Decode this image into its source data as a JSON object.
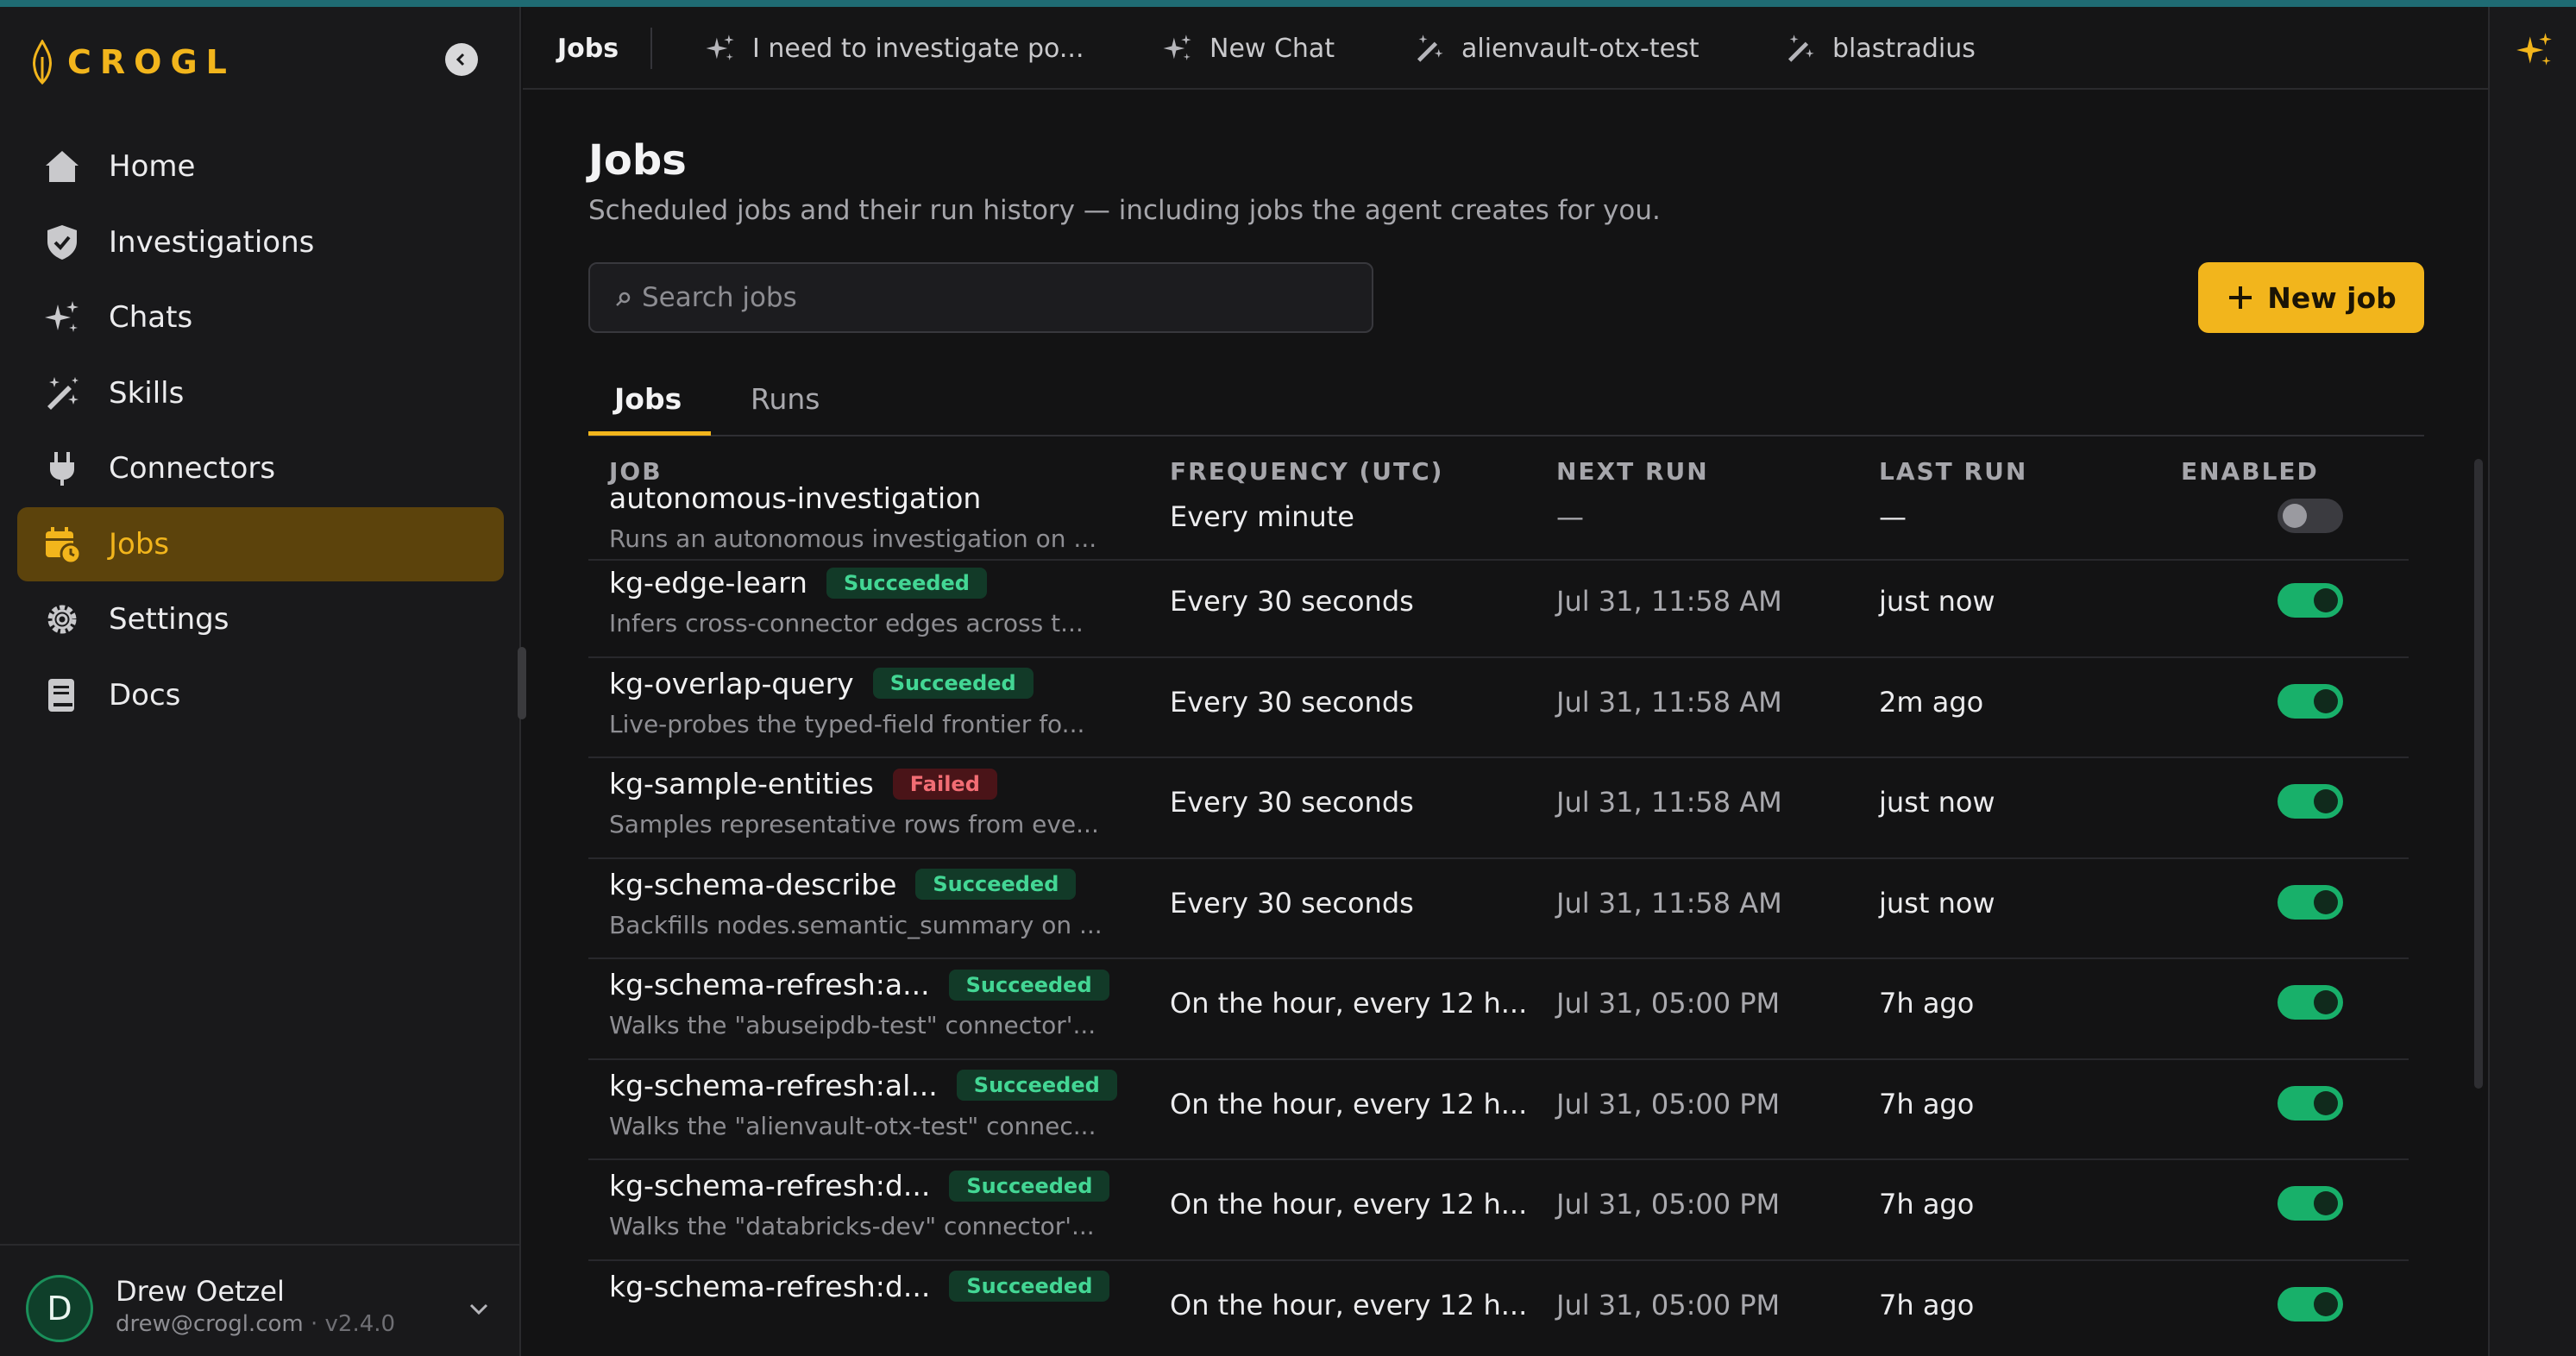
{
  "brand": {
    "name": "CROGL",
    "color": "#f2b51c"
  },
  "sidebar": {
    "items": [
      {
        "label": "Home",
        "icon": "home-icon"
      },
      {
        "label": "Investigations",
        "icon": "shield-icon"
      },
      {
        "label": "Chats",
        "icon": "sparkles-icon"
      },
      {
        "label": "Skills",
        "icon": "magic-wand-icon"
      },
      {
        "label": "Connectors",
        "icon": "plug-icon"
      },
      {
        "label": "Jobs",
        "icon": "calendar-clock-icon",
        "active": true
      },
      {
        "label": "Settings",
        "icon": "gear-icon"
      },
      {
        "label": "Docs",
        "icon": "book-icon"
      }
    ]
  },
  "user": {
    "initial": "D",
    "name": "Drew Oetzel",
    "email": "drew@crogl.com",
    "version": "· v2.4.0"
  },
  "tabs": [
    {
      "label": "Jobs",
      "active": true
    },
    {
      "label": "I need to investigate po...",
      "icon": "sparkles-icon"
    },
    {
      "label": "New Chat",
      "icon": "sparkles-icon"
    },
    {
      "label": "alienvault-otx-test",
      "icon": "magic-wand-icon"
    },
    {
      "label": "blastradius",
      "icon": "magic-wand-icon"
    }
  ],
  "page": {
    "title": "Jobs",
    "subtitle": "Scheduled jobs and their run history — including jobs the agent creates for you.",
    "search_placeholder": "Search jobs",
    "new_job_label": "New job",
    "subtabs": [
      "Jobs",
      "Runs"
    ]
  },
  "table": {
    "columns": [
      "JOB",
      "FREQUENCY (UTC)",
      "NEXT RUN",
      "LAST RUN",
      "ENABLED"
    ],
    "rows": [
      {
        "name": "autonomous-investigation",
        "status": "",
        "desc": "Runs an autonomous investigation on ...",
        "frequency": "Every minute",
        "next_run": "—",
        "last_run": "—",
        "enabled": false
      },
      {
        "name": "kg-edge-learn",
        "status": "Succeeded",
        "desc": "Infers cross-connector edges across t...",
        "frequency": "Every 30 seconds",
        "next_run": "Jul 31, 11:58 AM",
        "last_run": "just now",
        "enabled": true
      },
      {
        "name": "kg-overlap-query",
        "status": "Succeeded",
        "desc": "Live-probes the typed-field frontier fo...",
        "frequency": "Every 30 seconds",
        "next_run": "Jul 31, 11:58 AM",
        "last_run": "2m ago",
        "enabled": true
      },
      {
        "name": "kg-sample-entities",
        "status": "Failed",
        "desc": "Samples representative rows from eve...",
        "frequency": "Every 30 seconds",
        "next_run": "Jul 31, 11:58 AM",
        "last_run": "just now",
        "enabled": true
      },
      {
        "name": "kg-schema-describe",
        "status": "Succeeded",
        "desc": "Backfills nodes.semantic_summary on ...",
        "frequency": "Every 30 seconds",
        "next_run": "Jul 31, 11:58 AM",
        "last_run": "just now",
        "enabled": true
      },
      {
        "name": "kg-schema-refresh:a...",
        "status": "Succeeded",
        "desc": "Walks the \"abuseipdb-test\" connector'...",
        "frequency": "On the hour, every 12 h...",
        "next_run": "Jul 31, 05:00 PM",
        "last_run": "7h ago",
        "enabled": true
      },
      {
        "name": "kg-schema-refresh:al...",
        "status": "Succeeded",
        "desc": "Walks the \"alienvault-otx-test\" connec...",
        "frequency": "On the hour, every 12 h...",
        "next_run": "Jul 31, 05:00 PM",
        "last_run": "7h ago",
        "enabled": true
      },
      {
        "name": "kg-schema-refresh:d...",
        "status": "Succeeded",
        "desc": "Walks the \"databricks-dev\" connector'...",
        "frequency": "On the hour, every 12 h...",
        "next_run": "Jul 31, 05:00 PM",
        "last_run": "7h ago",
        "enabled": true
      },
      {
        "name": "kg-schema-refresh:d...",
        "status": "Succeeded",
        "desc": "",
        "frequency": "On the hour, every 12 h...",
        "next_run": "Jul 31, 05:00 PM",
        "last_run": "7h ago",
        "enabled": true
      }
    ]
  }
}
